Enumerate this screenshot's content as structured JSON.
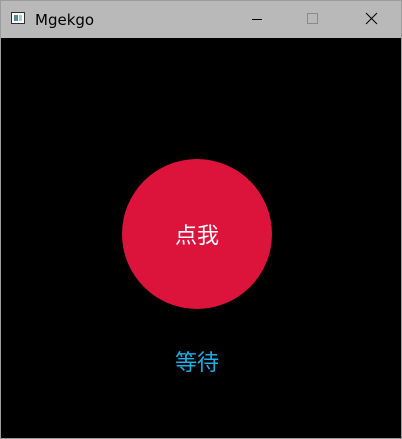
{
  "window": {
    "title": "Mgekgo",
    "icon": "app-window-icon",
    "controls": {
      "minimize_icon": "minimize-icon",
      "maximize_icon": "maximize-icon",
      "close_icon": "close-icon"
    }
  },
  "main": {
    "button_label": "点我",
    "status_label": "等待"
  },
  "colors": {
    "titlebar": "#b9b9b9",
    "background": "#000000",
    "button": "#dc143c",
    "button_text": "#ffffff",
    "status_text": "#1eaee6"
  }
}
